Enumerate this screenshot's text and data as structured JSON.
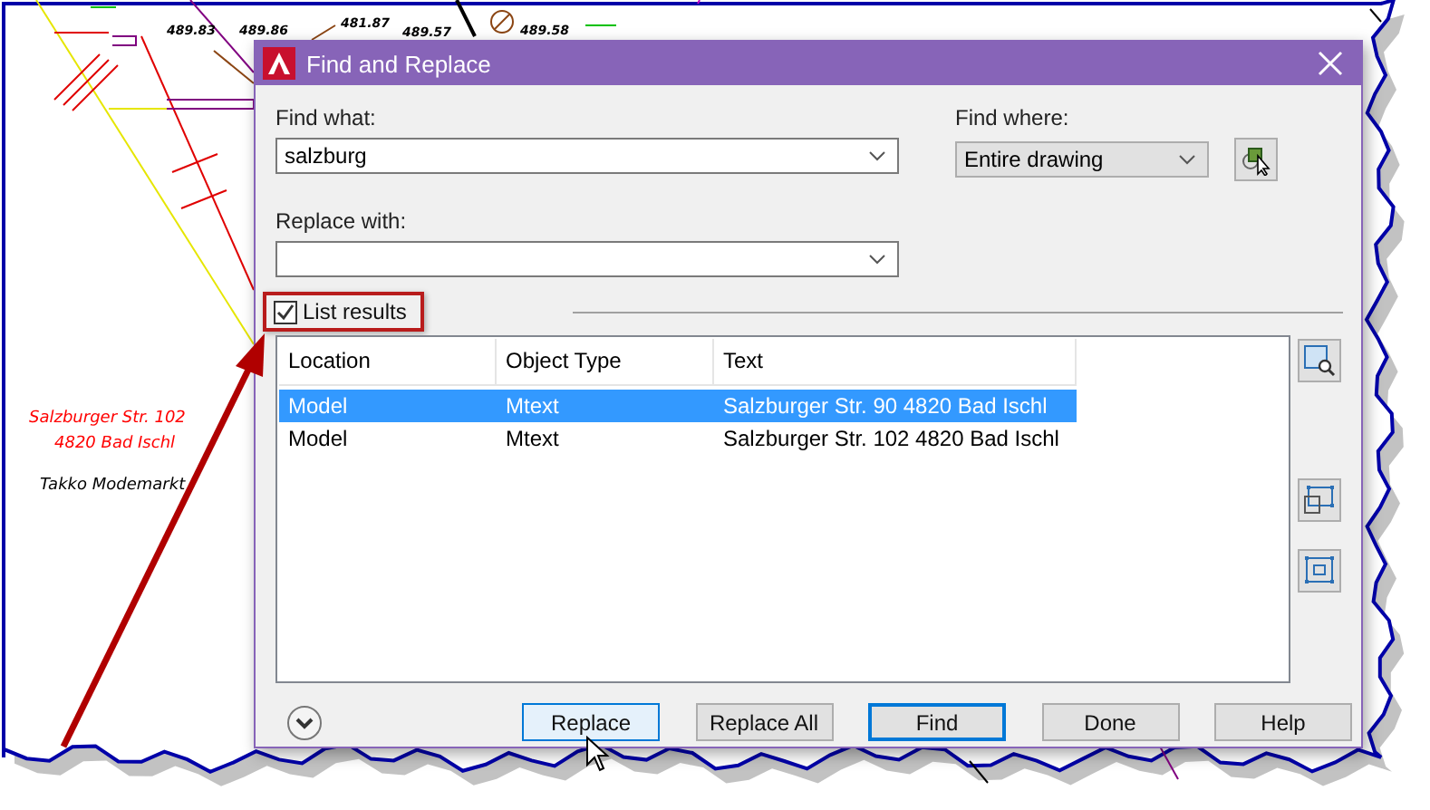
{
  "drawing": {
    "labels": [
      {
        "text": "489.83",
        "color": "#000000"
      },
      {
        "text": "489.86",
        "color": "#000000"
      },
      {
        "text": "481.87",
        "color": "#000000"
      },
      {
        "text": "489.57",
        "color": "#000000"
      },
      {
        "text": "489.58",
        "color": "#000000"
      },
      {
        "text": "Salzburger Str. 102",
        "color": "#ff0000"
      },
      {
        "text": "4820 Bad Ischl",
        "color": "#ff0000"
      },
      {
        "text": "Takko Modemarkt",
        "color": "#000000"
      }
    ]
  },
  "window": {
    "title": "Find and Replace"
  },
  "find_what": {
    "label": "Find what:",
    "value": "salzburg"
  },
  "find_where": {
    "label": "Find where:",
    "value": "Entire drawing"
  },
  "replace_with": {
    "label": "Replace with:"
  },
  "list_results": {
    "label": "List results",
    "checked": true
  },
  "results": {
    "columns": [
      "Location",
      "Object Type",
      "Text"
    ],
    "rows": [
      {
        "cells": [
          "Model",
          "Mtext",
          "Salzburger Str. 90 4820 Bad Ischl"
        ],
        "selected": true
      },
      {
        "cells": [
          "Model",
          "Mtext",
          "Salzburger Str. 102 4820 Bad Ischl"
        ],
        "selected": false
      }
    ]
  },
  "buttons": [
    {
      "label": "Replace",
      "kind": "hover"
    },
    {
      "label": "Replace All",
      "kind": "normal"
    },
    {
      "label": "Find",
      "kind": "default"
    },
    {
      "label": "Done",
      "kind": "normal"
    },
    {
      "label": "Help",
      "kind": "normal"
    }
  ]
}
